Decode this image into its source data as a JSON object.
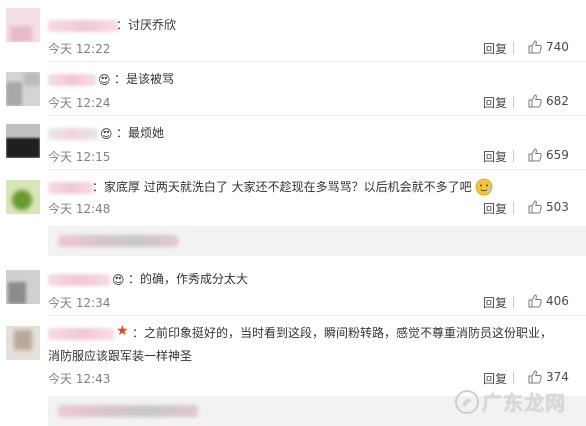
{
  "comments": [
    {
      "badge": "",
      "text": "：讨厌乔欣",
      "time": "今天 12:22",
      "reply": "回复",
      "likes": "740"
    },
    {
      "badge": "",
      "text": "：是该被骂",
      "time": "今天 12:24",
      "reply": "回复",
      "likes": "682"
    },
    {
      "badge": "",
      "text": "：最烦她",
      "time": "今天 12:15",
      "reply": "回复",
      "likes": "659"
    },
    {
      "badge": "",
      "text": "：家底厚 过两天就洗白了 大家还不趁现在多骂骂？以后机会就不多了吧",
      "time": "今天 12:48",
      "reply": "回复",
      "likes": "503"
    },
    {
      "badge": "",
      "text": "：的确，作秀成分太大",
      "time": "今天 12:34",
      "reply": "回复",
      "likes": "406"
    },
    {
      "badge": "",
      "text": "：之前印象挺好的，当时看到这段，瞬间粉转路，感觉不尊重消防员这份职业，消防服应该跟军装一样神圣",
      "time": "今天 12:43",
      "reply": "回复",
      "likes": "374"
    }
  ],
  "watermark": "广东龙网",
  "colors": {
    "text": "#333333",
    "time": "#808080",
    "sub_bg": "#f2f2f2",
    "emoji": "#f5c33b"
  }
}
